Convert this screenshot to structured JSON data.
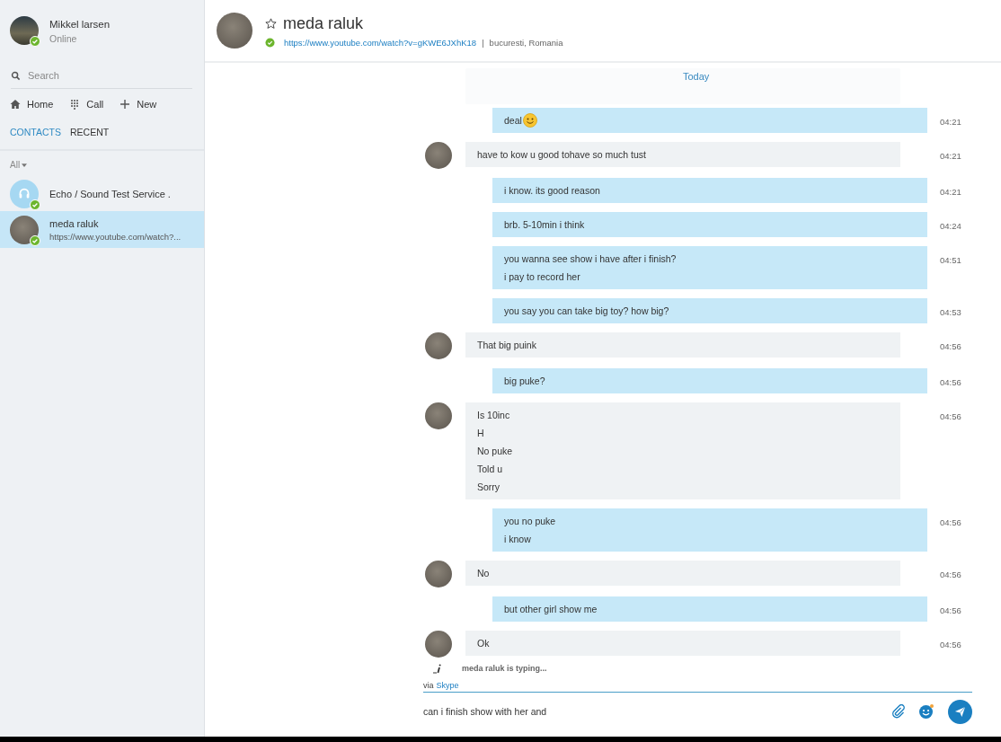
{
  "profile": {
    "name": "Mikkel larsen",
    "status": "Online",
    "online": true
  },
  "search": {
    "placeholder": "Search"
  },
  "nav": [
    {
      "label": "Home",
      "kind": "home"
    },
    {
      "label": "Call",
      "kind": "call"
    },
    {
      "label": "New",
      "kind": "new"
    }
  ],
  "tabs": [
    {
      "label": "CONTACTS",
      "selected": true
    },
    {
      "label": "RECENT",
      "selected": false
    }
  ],
  "filter": {
    "label": "All"
  },
  "contacts": [
    {
      "name": "Echo / Sound Test Service .",
      "kind": "echo",
      "online": true,
      "selected": false
    },
    {
      "name": "meda raluk",
      "subtitle": "https://www.youtube.com/watch?...",
      "kind": "person",
      "online": true,
      "selected": true
    }
  ],
  "conversation": {
    "name": "meda raluk",
    "online": true,
    "mood_link": "https://www.youtube.com/watch?v=gKWE6JXhK18",
    "separator": "|",
    "location": "bucuresti, Romania"
  },
  "day_label": "Today",
  "messages": [
    {
      "kind": "outgoing",
      "lines": [
        "deal"
      ],
      "emoticon": true,
      "time": "04:21"
    },
    {
      "kind": "incoming",
      "lines": [
        "have to kow u good tohave so much tust"
      ],
      "time": "04:21"
    },
    {
      "kind": "outgoing",
      "lines": [
        "i know. its good reason"
      ],
      "time": "04:21"
    },
    {
      "kind": "outgoing",
      "lines": [
        "brb. 5-10min i think"
      ],
      "time": "04:24"
    },
    {
      "kind": "outgoing",
      "lines": [
        "you wanna see show i have after i finish?",
        "i pay to record her"
      ],
      "time": "04:51"
    },
    {
      "kind": "outgoing",
      "lines": [
        "you say you can take big toy? how big?"
      ],
      "time": "04:53"
    },
    {
      "kind": "incoming",
      "lines": [
        "That big puink"
      ],
      "time": "04:56"
    },
    {
      "kind": "outgoing",
      "lines": [
        "big puke?"
      ],
      "time": "04:56"
    },
    {
      "kind": "incoming",
      "lines": [
        "Is 10inc",
        "H",
        "No puke",
        "Told u",
        "Sorry"
      ],
      "time": "04:56"
    },
    {
      "kind": "outgoing",
      "lines": [
        "you no puke",
        "i know"
      ],
      "time": "04:56"
    },
    {
      "kind": "incoming",
      "lines": [
        "No"
      ],
      "time": "04:56"
    },
    {
      "kind": "outgoing",
      "lines": [
        "but other girl show me"
      ],
      "time": "04:56"
    },
    {
      "kind": "incoming",
      "lines": [
        "Ok"
      ],
      "time": "04:56"
    }
  ],
  "typing": {
    "text": "meda raluk is typing..."
  },
  "via": {
    "prefix": "via",
    "service": "Skype"
  },
  "composer": {
    "value": "can i finish show with her and"
  }
}
